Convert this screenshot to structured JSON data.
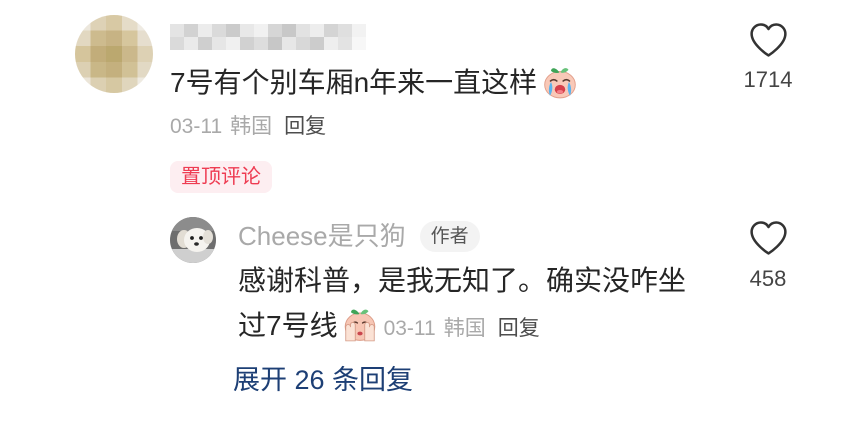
{
  "comment": {
    "avatar_icon": "blurred-avatar",
    "text": "7号有个别车厢n年来一直这样",
    "emoji": "crying-face-emoji",
    "date": "03-11",
    "location": "韩国",
    "reply_label": "回复",
    "like_icon": "heart-icon",
    "like_count": "1714",
    "pinned_label": "置顶评论"
  },
  "reply": {
    "avatar_icon": "dog-avatar",
    "username": "Cheese是只狗",
    "author_badge": "作者",
    "text": "感谢科普，是我无知了。确实没咋坐过7号线",
    "emoji": "face-palm-emoji",
    "date": "03-11",
    "location": "韩国",
    "reply_label": "回复",
    "like_icon": "heart-icon",
    "like_count": "458"
  },
  "expand_replies_label": "展开 26 条回复",
  "colors": {
    "text_primary": "#262626",
    "text_meta": "#a9a9a9",
    "pinned_badge_bg": "#fdeef1",
    "pinned_badge_text": "#ee3c52",
    "author_badge_bg": "#f3f3f3",
    "expand_link": "#1d3f75"
  }
}
